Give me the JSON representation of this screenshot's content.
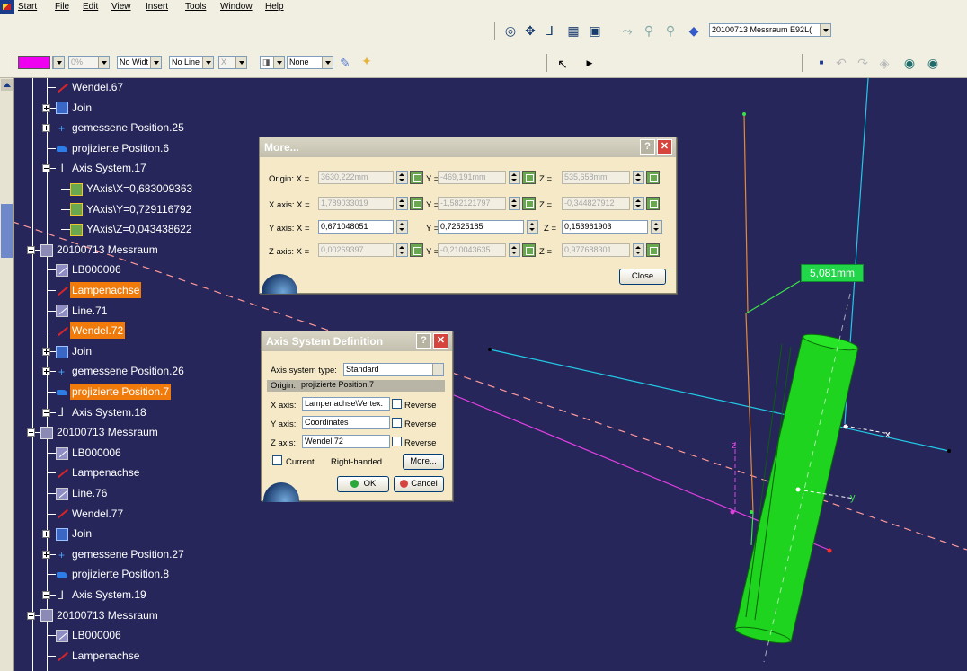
{
  "menu": [
    "Start",
    "File",
    "Edit",
    "View",
    "Insert",
    "Tools",
    "Window",
    "Help"
  ],
  "toolbar_top": {
    "product_combo": "20100713 Messraum E92L(",
    "icons": [
      "fit-all-icon",
      "pan-icon",
      "axis-icon",
      "grid-icon",
      "cube-view-icon",
      "rotate-icon",
      "zoom-icon",
      "zoom-out-icon",
      "layer-icon"
    ]
  },
  "toolbar_graphic": {
    "color_swatch": "#f000f0",
    "transparency_combo": "0%",
    "line_width_combo": "No Widt",
    "line_type_combo": "No Line",
    "point_combo": "X",
    "layer_combo": "None"
  },
  "tree": [
    {
      "label": "Wendel.67",
      "icon": "line",
      "sel": false
    },
    {
      "label": "Join",
      "icon": "join",
      "sel": false
    },
    {
      "label": "gemessene Position.25",
      "icon": "point",
      "sel": false
    },
    {
      "label": "projizierte Position.6",
      "icon": "proj",
      "sel": false
    },
    {
      "label": "Axis System.17",
      "icon": "axis",
      "sel": false
    },
    {
      "label": "YAxis\\X=0,683009363",
      "icon": "param",
      "sel": false
    },
    {
      "label": "YAxis\\Y=0,729116792",
      "icon": "param",
      "sel": false
    },
    {
      "label": "YAxis\\Z=0,043438622",
      "icon": "param",
      "sel": false
    },
    {
      "label": "20100713 Messraum",
      "icon": "geoset",
      "sel": false
    },
    {
      "label": "LB000006",
      "icon": "lb",
      "sel": false
    },
    {
      "label": "Lampenachse",
      "icon": "line",
      "sel": true
    },
    {
      "label": "Line.71",
      "icon": "lb",
      "sel": false
    },
    {
      "label": "Wendel.72",
      "icon": "line",
      "sel": true
    },
    {
      "label": "Join",
      "icon": "join",
      "sel": false
    },
    {
      "label": "gemessene Position.26",
      "icon": "point",
      "sel": false
    },
    {
      "label": "projizierte Position.7",
      "icon": "proj",
      "sel": true
    },
    {
      "label": "Axis System.18",
      "icon": "axis",
      "sel": false
    },
    {
      "label": "20100713 Messraum",
      "icon": "geoset",
      "sel": false
    },
    {
      "label": "LB000006",
      "icon": "lb",
      "sel": false
    },
    {
      "label": "Lampenachse",
      "icon": "line",
      "sel": false
    },
    {
      "label": "Line.76",
      "icon": "lb",
      "sel": false
    },
    {
      "label": "Wendel.77",
      "icon": "line",
      "sel": false
    },
    {
      "label": "Join",
      "icon": "join",
      "sel": false
    },
    {
      "label": "gemessene Position.27",
      "icon": "point",
      "sel": false
    },
    {
      "label": "projizierte Position.8",
      "icon": "proj",
      "sel": false
    },
    {
      "label": "Axis System.19",
      "icon": "axis",
      "sel": false
    },
    {
      "label": "20100713 Messraum",
      "icon": "geoset",
      "sel": false
    },
    {
      "label": "LB000006",
      "icon": "lb",
      "sel": false
    },
    {
      "label": "Lampenachse",
      "icon": "line",
      "sel": false
    }
  ],
  "more_dialog": {
    "title": "More...",
    "origin_label": "Origin: X =",
    "origin_x": "3630,222mm",
    "origin_y": "-469,191mm",
    "origin_z": "535,658mm",
    "xaxis_label": "X axis: X =",
    "xaxis_x": "1,789033019",
    "xaxis_y": "-1,582121797",
    "xaxis_z": "-0,344827912",
    "yaxis_label": "Y axis: X =",
    "yaxis_x": "0,671048051",
    "yaxis_y": "0,72525185",
    "yaxis_z": "0,153961903",
    "zaxis_label": "Z axis: X =",
    "zaxis_x": "0,00269397",
    "zaxis_y": "-0,210043635",
    "zaxis_z": "0,977688301",
    "y_eq": "Y =",
    "z_eq": "Z =",
    "close": "Close"
  },
  "axis_dialog": {
    "title": "Axis System Definition",
    "type_label": "Axis system type:",
    "type_value": "Standard",
    "origin_label": "Origin:",
    "origin_value": "projizierte Position.7",
    "x_label": "X axis:",
    "x_value": "Lampenachse\\Vertex.",
    "y_label": "Y axis:",
    "y_value": "Coordinates",
    "z_label": "Z axis:",
    "z_value": "Wendel.72",
    "reverse": "Reverse",
    "current": "Current",
    "right_handed": "Right-handed",
    "more": "More...",
    "ok": "OK",
    "cancel": "Cancel"
  },
  "viewport": {
    "dimension_label": "5,081mm",
    "axis_labels": {
      "x": "x",
      "y": "y",
      "z": "z"
    }
  }
}
